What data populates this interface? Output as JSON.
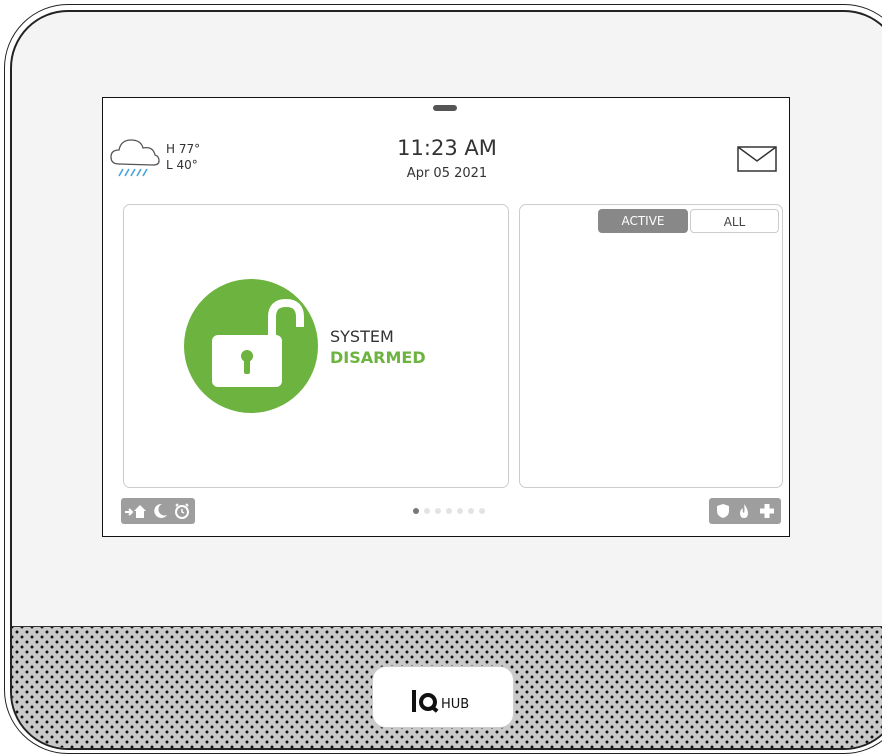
{
  "weather": {
    "high": "H 77°",
    "low": "L 40°",
    "icon": "rain-cloud-icon"
  },
  "clock": {
    "time": "11:23 AM",
    "date": "Apr 05 2021"
  },
  "messages": {
    "icon": "envelope-icon"
  },
  "system_status": {
    "line1": "SYSTEM",
    "line2": "DISARMED",
    "icon": "unlocked-padlock-icon",
    "color": "#6db33f"
  },
  "event_tabs": {
    "active_label": "ACTIVE",
    "all_label": "ALL",
    "selected": "ACTIVE"
  },
  "quick_actions_left": [
    "arm-stay-icon",
    "night-mode-icon",
    "alarm-clock-icon"
  ],
  "quick_actions_right": [
    "police-shield-icon",
    "fire-icon",
    "medical-cross-icon"
  ],
  "pagination": {
    "total": 7,
    "current": 1
  },
  "brand": {
    "logo_text": "IQ",
    "product": "HUB"
  },
  "colors": {
    "accent_green": "#6db33f",
    "button_grey": "#9e9e9e",
    "tab_active": "#888888"
  }
}
